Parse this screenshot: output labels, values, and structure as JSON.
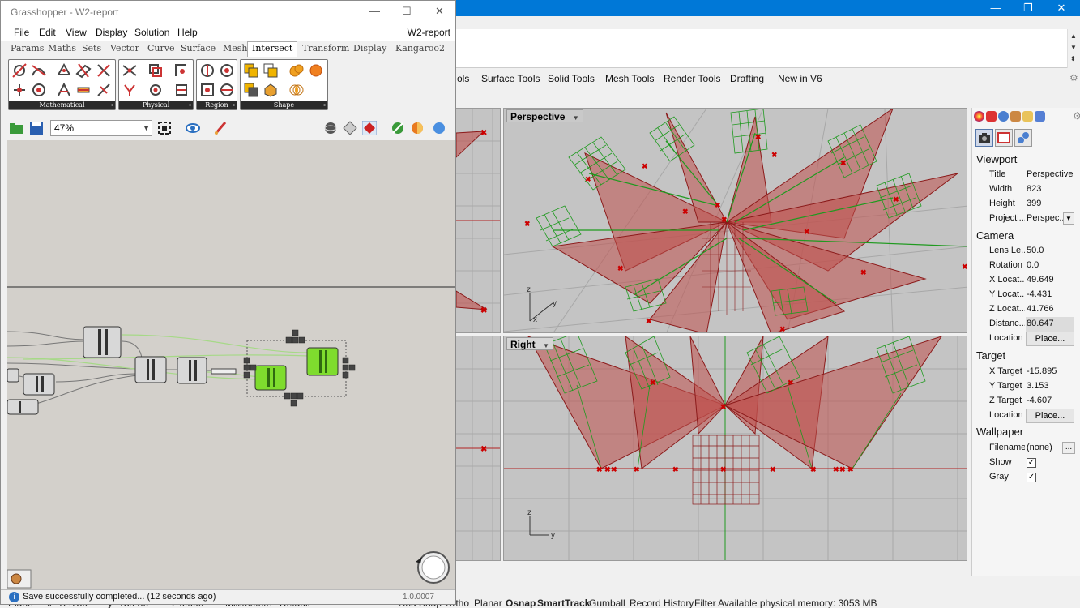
{
  "grasshopper": {
    "title": "Grasshopper - W2-report",
    "window_buttons": {
      "minimize": "—",
      "maximize": "☐",
      "close": "✕"
    },
    "menu": [
      "File",
      "Edit",
      "View",
      "Display",
      "Solution",
      "Help"
    ],
    "document_name": "W2-report",
    "tabs": [
      "Params",
      "Maths",
      "Sets",
      "Vector",
      "Curve",
      "Surface",
      "Mesh",
      "Intersect",
      "Transform",
      "Display",
      "Kangaroo2"
    ],
    "active_tab": "Intersect",
    "groups": [
      "Mathematical",
      "Physical",
      "Region",
      "Shape"
    ],
    "zoom": "47%",
    "status_message": "Save successfully completed... (12 seconds ago)",
    "version": "1.0.0007",
    "colors": {
      "canvas": "#d3d0cb",
      "component_active": "#7fdc2e",
      "component_dark": "#3a3a3a"
    }
  },
  "rhino": {
    "window_buttons": {
      "minimize": "—",
      "restore": "❐",
      "close": "✕"
    },
    "tabs": [
      "ols",
      "Surface Tools",
      "Solid Tools",
      "Mesh Tools",
      "Render Tools",
      "Drafting",
      "New in V6"
    ],
    "viewports": [
      {
        "label": "Perspective",
        "active": true
      },
      {
        "label": "Right",
        "active": false
      }
    ],
    "axis_labels": {
      "z": "z",
      "y": "y",
      "x": "x"
    },
    "properties": {
      "viewport": {
        "heading": "Viewport",
        "rows": [
          {
            "key": "Title",
            "value": "Perspective"
          },
          {
            "key": "Width",
            "value": "823"
          },
          {
            "key": "Height",
            "value": "399"
          },
          {
            "key": "Projecti...",
            "value": "Perspec..."
          }
        ]
      },
      "camera": {
        "heading": "Camera",
        "rows": [
          {
            "key": "Lens Le...",
            "value": "50.0"
          },
          {
            "key": "Rotation",
            "value": "0.0"
          },
          {
            "key": "X Locat...",
            "value": "49.649"
          },
          {
            "key": "Y Locat...",
            "value": "-4.431"
          },
          {
            "key": "Z Locat...",
            "value": "41.766"
          },
          {
            "key": "Distanc...",
            "value": "80.647"
          },
          {
            "key": "Location",
            "value": "Place..."
          }
        ]
      },
      "target": {
        "heading": "Target",
        "rows": [
          {
            "key": "X Target",
            "value": "-15.895"
          },
          {
            "key": "Y Target",
            "value": "3.153"
          },
          {
            "key": "Z Target",
            "value": "-4.607"
          },
          {
            "key": "Location",
            "value": "Place..."
          }
        ]
      },
      "wallpaper": {
        "heading": "Wallpaper",
        "rows": [
          {
            "key": "Filename",
            "value": "(none)"
          },
          {
            "key": "Show",
            "value": "✓"
          },
          {
            "key": "Gray",
            "value": "✓"
          }
        ]
      },
      "more_button": "..."
    },
    "status_bar": {
      "coords": [
        "Plane",
        "x -12.730",
        "y -15.286",
        "z 0.000"
      ],
      "units": "Millimeters",
      "layer": "Default",
      "toggles": [
        "Grid Snap",
        "Ortho",
        "Planar",
        "Osnap",
        "SmartTrack",
        "Gumball",
        "Record History",
        "Filter"
      ],
      "bold_toggles": [
        "Osnap",
        "SmartTrack"
      ],
      "memory": "Available physical memory: 3053 MB"
    },
    "colors": {
      "titlebar": "#0078d7",
      "viewport_bg": "#c4c4c4",
      "geometry": "#b22222",
      "grid_lines": "#1f9a1f"
    }
  }
}
